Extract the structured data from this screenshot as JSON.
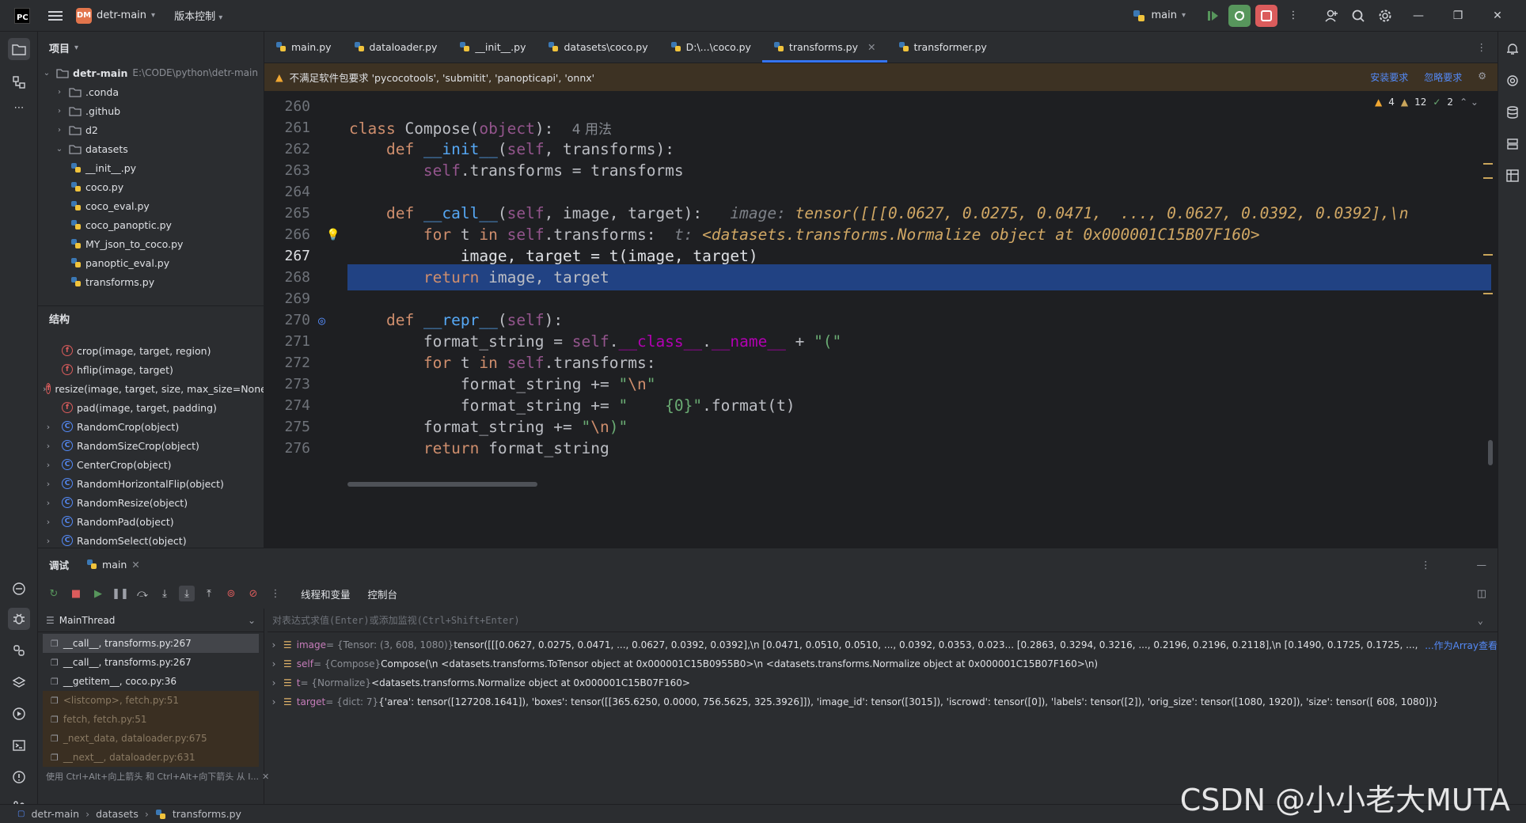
{
  "titlebar": {
    "logo": "PC",
    "project_initials": "DM",
    "project_name": "detr-main",
    "vcs_menu": "版本控制",
    "run_config": "main"
  },
  "project_panel": {
    "title": "项目",
    "root": {
      "name": "detr-main",
      "path": "E:\\CODE\\python\\detr-main"
    },
    "items": [
      {
        "name": ".conda",
        "kind": "folder"
      },
      {
        "name": ".github",
        "kind": "folder"
      },
      {
        "name": "d2",
        "kind": "folder"
      },
      {
        "name": "datasets",
        "kind": "folder-open"
      },
      {
        "name": "__init__.py",
        "kind": "py"
      },
      {
        "name": "coco.py",
        "kind": "py"
      },
      {
        "name": "coco_eval.py",
        "kind": "py"
      },
      {
        "name": "coco_panoptic.py",
        "kind": "py"
      },
      {
        "name": "MY_json_to_coco.py",
        "kind": "py"
      },
      {
        "name": "panoptic_eval.py",
        "kind": "py"
      },
      {
        "name": "transforms.py",
        "kind": "py"
      }
    ]
  },
  "structure_panel": {
    "title": "结构",
    "items": [
      {
        "label": "crop(image, target, region)",
        "kind": "f",
        "expand": false
      },
      {
        "label": "hflip(image, target)",
        "kind": "f",
        "expand": false
      },
      {
        "label": "resize(image, target, size, max_size=None)",
        "kind": "f",
        "expand": true
      },
      {
        "label": "pad(image, target, padding)",
        "kind": "f",
        "expand": false
      },
      {
        "label": "RandomCrop(object)",
        "kind": "c",
        "expand": true
      },
      {
        "label": "RandomSizeCrop(object)",
        "kind": "c",
        "expand": true
      },
      {
        "label": "CenterCrop(object)",
        "kind": "c",
        "expand": true
      },
      {
        "label": "RandomHorizontalFlip(object)",
        "kind": "c",
        "expand": true
      },
      {
        "label": "RandomResize(object)",
        "kind": "c",
        "expand": true
      },
      {
        "label": "RandomPad(object)",
        "kind": "c",
        "expand": true
      },
      {
        "label": "RandomSelect(object)",
        "kind": "c",
        "expand": true
      }
    ]
  },
  "editor": {
    "tabs": [
      {
        "label": "main.py"
      },
      {
        "label": "dataloader.py"
      },
      {
        "label": "__init__.py"
      },
      {
        "label": "datasets\\coco.py"
      },
      {
        "label": "D:\\...\\coco.py"
      },
      {
        "label": "transforms.py",
        "active": true
      },
      {
        "label": "transformer.py"
      }
    ],
    "warning": {
      "text": "不满足软件包要求 'pycocotools', 'submitit', 'panopticapi', 'onnx'",
      "install": "安装要求",
      "ignore": "忽略要求"
    },
    "inspections": {
      "warnings": "4",
      "weak": "12",
      "ok": "2"
    },
    "lines": [
      {
        "n": "260"
      },
      {
        "n": "261"
      },
      {
        "n": "262"
      },
      {
        "n": "263"
      },
      {
        "n": "264"
      },
      {
        "n": "265"
      },
      {
        "n": "266"
      },
      {
        "n": "267"
      },
      {
        "n": "268"
      },
      {
        "n": "269"
      },
      {
        "n": "270"
      },
      {
        "n": "271"
      },
      {
        "n": "272"
      },
      {
        "n": "273"
      },
      {
        "n": "274"
      },
      {
        "n": "275"
      },
      {
        "n": "276"
      }
    ],
    "code": {
      "l261_kw": "class ",
      "l261_name": "Compose(",
      "l261_obj": "object",
      "l261_end": "):",
      "l261_hint": "4 用法",
      "l262_kw": "def ",
      "l262_fn": "__init__",
      "l262_p1": "(",
      "l262_self": "self",
      "l262_rest": ", transforms):",
      "l263_self": "self",
      "l263_rest": ".transforms = transforms",
      "l265_kw": "def ",
      "l265_fn": "__call__",
      "l265_p1": "(",
      "l265_self": "self",
      "l265_rest": ", image, target):",
      "l265_inl_label": "image: ",
      "l265_inl_val": "tensor([[[0.0627, 0.0275, 0.0471,  ..., 0.0627, 0.0392, 0.0392],\\n",
      "l266_kw": "for ",
      "l266_mid": "t ",
      "l266_in": "in ",
      "l266_self": "self",
      "l266_rest": ".transforms:",
      "l266_inl_label": "t: ",
      "l266_inl_val": "<datasets.transforms.Normalize object at 0x000001C15B07F160>",
      "l267": "image, target = t(image, target)",
      "l268_kw": "return ",
      "l268_rest": "image, target",
      "l270_kw": "def ",
      "l270_fn": "__repr__",
      "l270_p1": "(",
      "l270_self": "self",
      "l270_rest": "):",
      "l271_a": "format_string = ",
      "l271_self": "self",
      "l271_b": ".",
      "l271_cls": "__class__",
      "l271_c": ".",
      "l271_nm": "__name__",
      "l271_d": " + ",
      "l271_str": "\"(\"",
      "l272_kw": "for ",
      "l272_mid": "t ",
      "l272_in": "in ",
      "l272_self": "self",
      "l272_rest": ".transforms:",
      "l273_a": "format_string += ",
      "l273_q1": "\"",
      "l273_esc": "\\n",
      "l273_q2": "\"",
      "l274_a": "format_string += ",
      "l274_str": "\"    {0}\"",
      "l274_rest": ".format(t)",
      "l275_a": "format_string += ",
      "l275_q1": "\"",
      "l275_esc": "\\n",
      "l275_q2": ")\"",
      "l276_kw": "return ",
      "l276_rest": "format_string"
    }
  },
  "debug": {
    "tab_debug": "调试",
    "tab_main": "main",
    "subtab_threads": "线程和变量",
    "subtab_console": "控制台",
    "thread": "MainThread",
    "eval_placeholder": "对表达式求值(Enter)或添加监视(Ctrl+Shift+Enter)",
    "frames": [
      {
        "label": "__call__, transforms.py:267",
        "state": "sel"
      },
      {
        "label": "__call__, transforms.py:267",
        "state": ""
      },
      {
        "label": "__getitem__, coco.py:36",
        "state": ""
      },
      {
        "label": "<listcomp>, fetch.py:51",
        "state": "dim"
      },
      {
        "label": "fetch, fetch.py:51",
        "state": "dim"
      },
      {
        "label": "_next_data, dataloader.py:675",
        "state": "dim"
      },
      {
        "label": "__next__, dataloader.py:631",
        "state": "dim"
      }
    ],
    "frames_hint": "使用 Ctrl+Alt+向上箭头 和 Ctrl+Alt+向下箭头 从 I...",
    "vars": [
      {
        "name": "image",
        "type": " = {Tensor: (3, 608, 1080)} ",
        "value": "tensor([[[0.0627, 0.0275, 0.0471,  ..., 0.0627, 0.0392, 0.0392],\\n         [0.0471, 0.0510, 0.0510,  ..., 0.0392, 0.0353, 0.023...     [0.2863, 0.3294, 0.3216,  ..., 0.2196, 0.2196, 0.2118],\\n         [0.1490, 0.1725, 0.1725,  ..., 0.",
        "link": "...作为Array查看"
      },
      {
        "name": "self",
        "type": " = {Compose} ",
        "value": "Compose(\\n    <datasets.transforms.ToTensor object at 0x000001C15B0955B0>\\n    <datasets.transforms.Normalize object at 0x000001C15B07F160>\\n)",
        "link": ""
      },
      {
        "name": "t",
        "type": " = {Normalize} ",
        "value": "<datasets.transforms.Normalize object at 0x000001C15B07F160>",
        "link": ""
      },
      {
        "name": "target",
        "type": " = {dict: 7} ",
        "value": "{'area': tensor([127208.1641]), 'boxes': tensor([[365.6250,   0.0000, 756.5625, 325.3926]]), 'image_id': tensor([3015]), 'iscrowd': tensor([0]), 'labels': tensor([2]), 'orig_size': tensor([1080, 1920]), 'size': tensor([ 608, 1080])}",
        "link": ""
      }
    ]
  },
  "statusbar": {
    "crumbs": [
      "detr-main",
      "datasets",
      "transforms.py"
    ]
  },
  "watermark": "CSDN @小小老大MUTA",
  "colors": {
    "accent": "#3574f0",
    "selection": "#214283",
    "keyword": "#cf8e6d",
    "function": "#56a8f5",
    "string": "#6aab73"
  }
}
